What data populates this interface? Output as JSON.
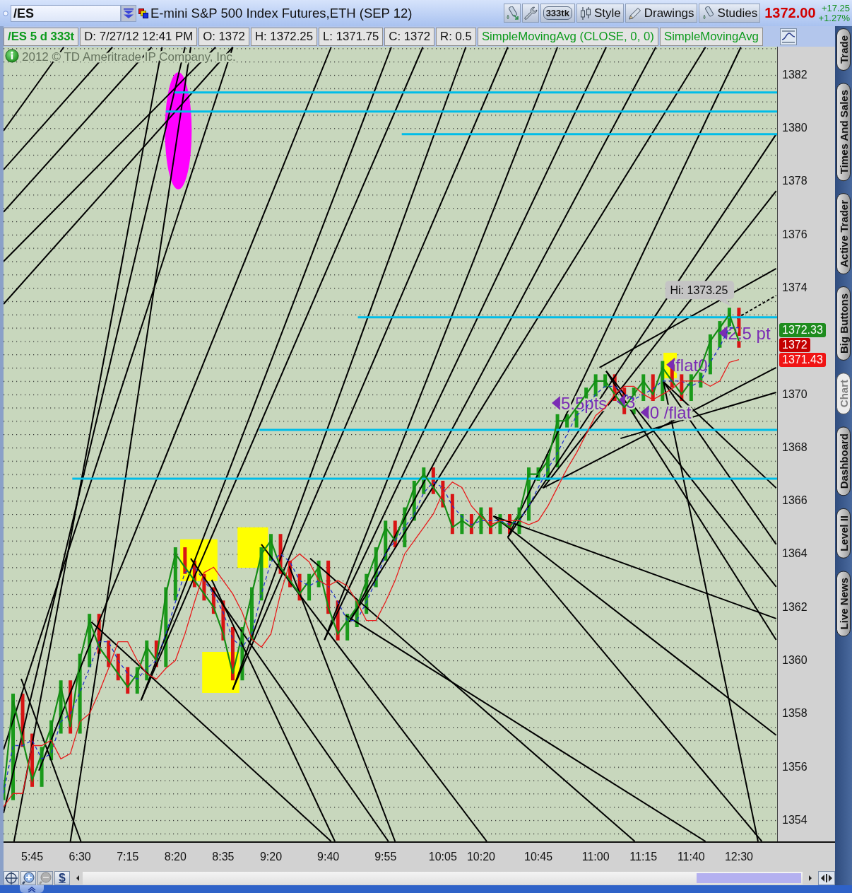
{
  "header": {
    "symbol": "/ES",
    "title": "E-mini S&P 500 Index Futures,ETH (SEP 12)",
    "tools": [
      {
        "kind": "flask_arrow"
      },
      {
        "kind": "wrench"
      },
      {
        "kind": "ticks",
        "label": "333tk"
      },
      {
        "kind": "style",
        "label": "Style"
      },
      {
        "kind": "drawings",
        "label": "Drawings"
      },
      {
        "kind": "studies",
        "label": "Studies"
      }
    ],
    "last_price": "1372.00",
    "net_change": "+17.25",
    "percent_change": "+1.27%"
  },
  "info_bar": {
    "cells": [
      {
        "kind": "symbol",
        "text": "/ES 5 d 333t"
      },
      {
        "kind": "value",
        "text": "D: 7/27/12 12:41 PM"
      },
      {
        "kind": "value",
        "text": "O: 1372"
      },
      {
        "kind": "value",
        "text": "H: 1372.25"
      },
      {
        "kind": "value",
        "text": "L: 1371.75"
      },
      {
        "kind": "value",
        "text": "C: 1372"
      },
      {
        "kind": "value",
        "text": "R: 0.5"
      },
      {
        "kind": "study",
        "text": "SimpleMovingAvg (CLOSE, 0, 0)"
      },
      {
        "kind": "study",
        "text": "SimpleMovingAvg"
      }
    ]
  },
  "chart": {
    "copyright": "2012 © TD Ameritrade IP Company, Inc.",
    "high_label": "Hi: 1373.25",
    "notes": [
      "5.5pts",
      "3",
      "0 /flat",
      "flat0",
      "2.5 pt"
    ],
    "price_tags": [
      {
        "text": "1372.33",
        "color": "#1e8c1e"
      },
      {
        "text": "1372",
        "color": "#c40000"
      },
      {
        "text": "1371.43",
        "color": "#f01414"
      }
    ],
    "chart_data": {
      "type": "line",
      "categories": [
        null,
        null,
        null,
        "5:45",
        null,
        null,
        null,
        null,
        "6:30",
        null,
        null,
        null,
        null,
        "7:15",
        null,
        null,
        null,
        null,
        "8:20",
        null,
        null,
        null,
        null,
        "8:35",
        null,
        null,
        null,
        null,
        "9:20",
        null,
        null,
        null,
        null,
        null,
        "9:40",
        null,
        null,
        null,
        null,
        null,
        "9:55",
        null,
        null,
        null,
        null,
        null,
        "10:05",
        null,
        null,
        null,
        "10:20",
        null,
        null,
        null,
        null,
        null,
        "10:45",
        null,
        null,
        null,
        null,
        null,
        "11:00",
        null,
        null,
        null,
        null,
        "11:15",
        null,
        null,
        null,
        null,
        "11:40",
        null,
        null,
        null,
        null,
        "12:30"
      ],
      "series": [
        {
          "color": "#148c14",
          "values": [
            1355,
            1358.5,
            1357,
            1355.5,
            1356.5,
            1357.5,
            1359,
            1357.5,
            1360,
            1361.5,
            1360.5,
            1360,
            1359.5,
            1359,
            1359.5,
            1360.5,
            1360,
            1362.5,
            1364,
            1363.5,
            1363,
            1362.5,
            1362,
            1361,
            1359.5,
            1361,
            1362.5,
            1364,
            1364.5,
            1363.5,
            1363,
            1362.5,
            1363,
            1363.5,
            1362,
            1361,
            1361.5,
            1362,
            1363,
            1364,
            1365,
            1364.5,
            1365.5,
            1366.5,
            1367,
            1366.5,
            1366,
            1365,
            1365.25,
            1365,
            1365.5,
            1365,
            1365.25,
            1365,
            1365.5,
            1367,
            1367,
            1367.5,
            1369,
            1369,
            1369.5,
            1370,
            1370.5,
            1370.5,
            1370,
            1369.5,
            1370,
            1370.5,
            1370,
            1371,
            1370.5,
            1370,
            1370.5,
            1371,
            1372,
            1372.5,
            1373,
            1372
          ]
        },
        {
          "color": "#2233cc",
          "line_style": "dashed",
          "values": [
            1355,
            1356.8,
            1356.8,
            1357,
            1356.3,
            1356.5,
            1357.7,
            1358,
            1358.8,
            1359.7,
            1360.7,
            1360.7,
            1360,
            1359.5,
            1359.3,
            1359.7,
            1360,
            1361,
            1362.2,
            1363.3,
            1363.5,
            1363,
            1362.5,
            1361.8,
            1360.8,
            1360.5,
            1361,
            1362.5,
            1363.7,
            1364,
            1363.7,
            1363,
            1362.8,
            1363,
            1362.8,
            1362.2,
            1361.5,
            1361.5,
            1362.2,
            1363,
            1364,
            1364.5,
            1365,
            1365.5,
            1366.3,
            1366.7,
            1366.5,
            1365.8,
            1365.4,
            1365.1,
            1365.25,
            1365.25,
            1365.25,
            1365.1,
            1365.25,
            1365.8,
            1366.5,
            1367.2,
            1367.8,
            1368.5,
            1369.2,
            1369.5,
            1370,
            1370.3,
            1370.3,
            1370,
            1369.8,
            1370,
            1370.2,
            1370.5,
            1370.5,
            1370.5,
            1370.3,
            1370.5,
            1371.2,
            1371.8,
            1372.5,
            1372.5
          ]
        },
        {
          "color": "#e81c1c",
          "values": [
            1354.5,
            1355,
            1355,
            1356.8,
            1356.8,
            1357,
            1356.3,
            1356.5,
            1357.7,
            1358,
            1358.8,
            1359.7,
            1360.7,
            1360.7,
            1360,
            1359.5,
            1359.3,
            1359.7,
            1360,
            1361,
            1362.2,
            1363.3,
            1363.5,
            1363,
            1362.5,
            1361.8,
            1360.8,
            1360.5,
            1361,
            1362.5,
            1363.7,
            1364,
            1363.7,
            1363,
            1362.8,
            1363,
            1362.8,
            1362.2,
            1361.5,
            1361.5,
            1362.2,
            1363,
            1364,
            1364.5,
            1365,
            1365.5,
            1366.3,
            1366.7,
            1366.5,
            1365.8,
            1365.4,
            1365.1,
            1365.25,
            1365.25,
            1365.25,
            1365.1,
            1365.25,
            1365.8,
            1366.5,
            1367.2,
            1367.8,
            1368.5,
            1369.2,
            1369.5,
            1370,
            1370.3,
            1370.3,
            1370,
            1369.8,
            1370,
            1370.2,
            1370.5,
            1370.5,
            1370.5,
            1370.3,
            1370.5,
            1371.2,
            1371.3
          ]
        }
      ],
      "ylim": [
        1353.2,
        1383.06
      ],
      "yticks": [
        1354,
        1356,
        1358,
        1360,
        1362,
        1364,
        1366,
        1368,
        1370,
        1374,
        1376,
        1378,
        1380,
        1382
      ]
    }
  },
  "side_tabs": [
    {
      "label": "Trade",
      "selected": false
    },
    {
      "label": "Times And Sales",
      "selected": false
    },
    {
      "label": "Active Trader",
      "selected": false
    },
    {
      "label": "Big Buttons",
      "selected": false
    },
    {
      "label": "Chart",
      "selected": true
    },
    {
      "label": "Dashboard",
      "selected": false
    },
    {
      "label": "Level II",
      "selected": false
    },
    {
      "label": "Live News",
      "selected": false
    }
  ],
  "bottom_bar": {
    "tools": [
      {
        "kind": "crosshair",
        "disabled": false
      },
      {
        "kind": "zoom_in",
        "disabled": false
      },
      {
        "kind": "zoom_out",
        "disabled": true
      },
      {
        "kind": "currency",
        "label": "$",
        "disabled": false
      }
    ]
  }
}
